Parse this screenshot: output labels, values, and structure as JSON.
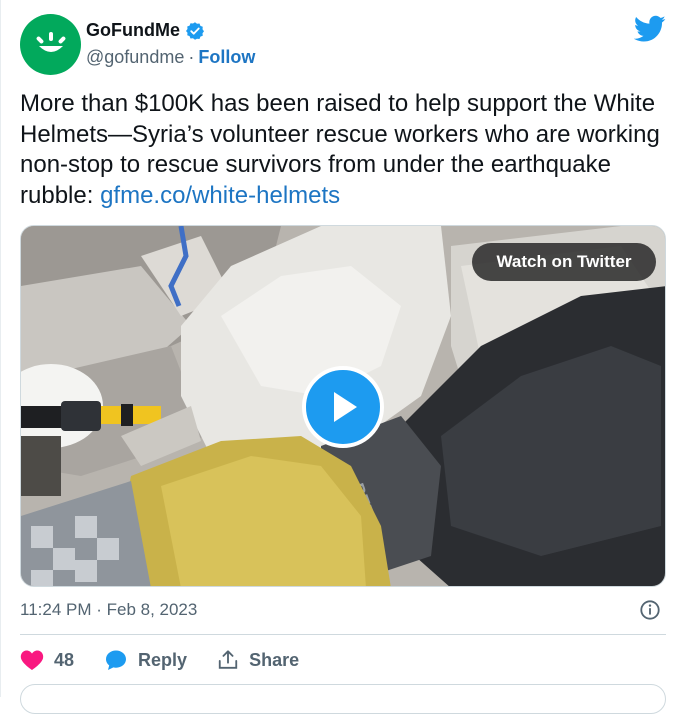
{
  "author": {
    "display_name": "GoFundMe",
    "handle": "@gofundme",
    "separator": "·",
    "follow_label": "Follow"
  },
  "tweet": {
    "text_before_link": "More than $100K has been raised to help support the White Helmets—Syria’s volunteer rescue workers who are working non-stop to rescue survivors from under the earthquake rubble: ",
    "link_text": "gfme.co/white-helmets"
  },
  "media": {
    "watch_label": "Watch on Twitter",
    "play_icon": "play-icon",
    "glove_brand": "PETZL"
  },
  "footer": {
    "timestamp": "11:24 PM · Feb 8, 2023"
  },
  "actions": {
    "like_count": "48",
    "reply_label": "Reply",
    "share_label": "Share"
  },
  "colors": {
    "brand_green": "#02a95c",
    "twitter_blue": "#1d9bf0",
    "link_blue": "#1d75c3",
    "like_pink": "#f91880",
    "muted_text": "#536471"
  }
}
